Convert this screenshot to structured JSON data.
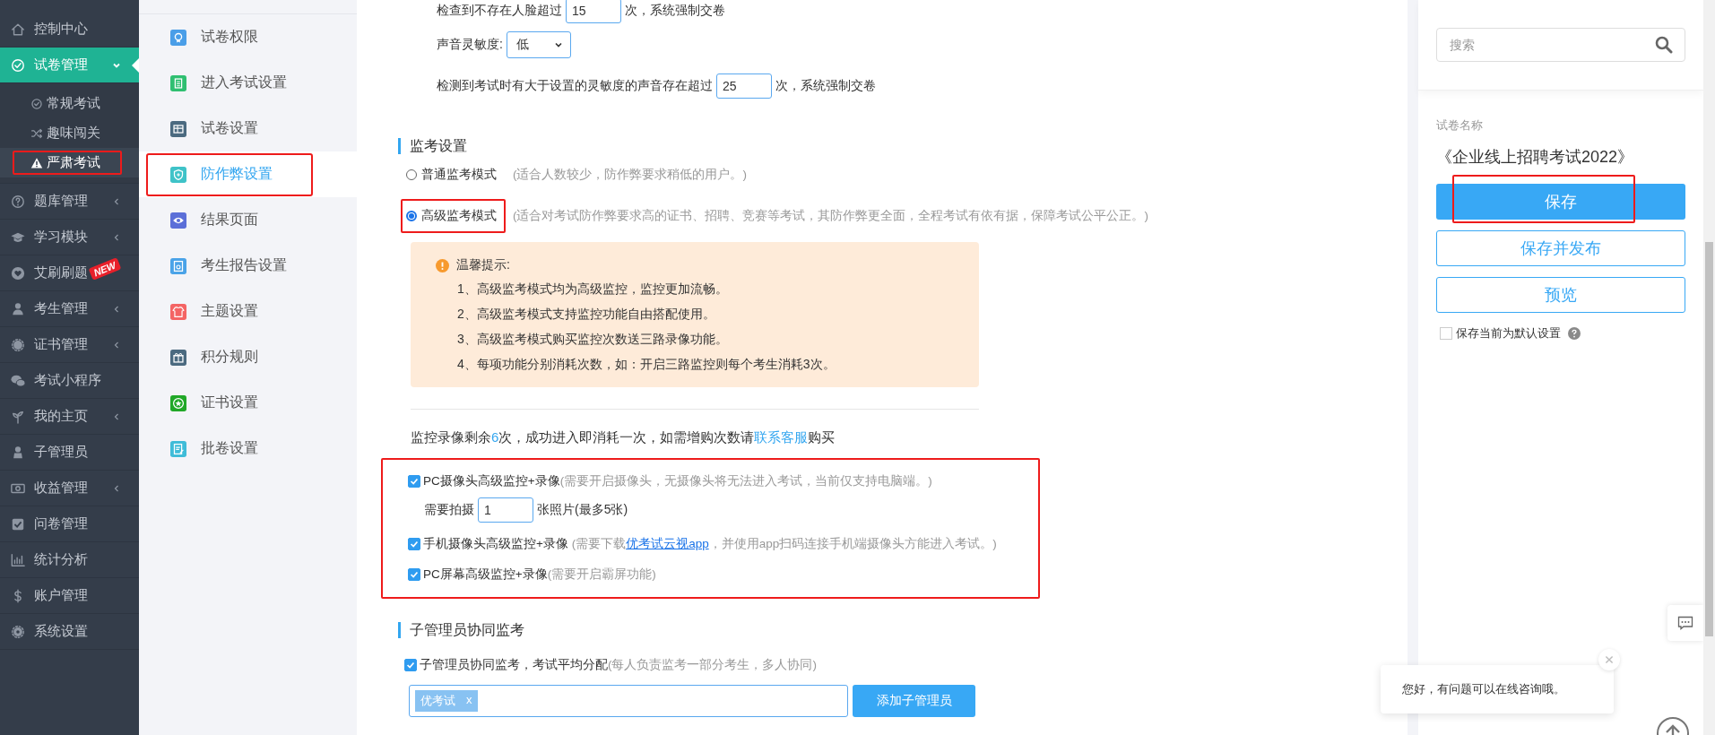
{
  "sidebar": {
    "items": [
      {
        "label": "控制中心",
        "selected": false,
        "expandable": false
      },
      {
        "label": "试卷管理",
        "selected": true,
        "expandable": true,
        "expanded": true,
        "children": [
          {
            "label": "常规考试",
            "selected": false,
            "highlighted": false
          },
          {
            "label": "趣味闯关",
            "selected": false,
            "highlighted": false
          },
          {
            "label": "严肃考试",
            "selected": true,
            "highlighted": true
          }
        ]
      },
      {
        "label": "题库管理",
        "selected": false,
        "expandable": true,
        "expanded": false
      },
      {
        "label": "学习模块",
        "selected": false,
        "expandable": true,
        "expanded": false
      },
      {
        "label": "艾刷刷题",
        "selected": false,
        "expandable": false,
        "badge": "NEW"
      },
      {
        "label": "考生管理",
        "selected": false,
        "expandable": true,
        "expanded": false
      },
      {
        "label": "证书管理",
        "selected": false,
        "expandable": true,
        "expanded": false
      },
      {
        "label": "考试小程序",
        "selected": false,
        "expandable": false
      },
      {
        "label": "我的主页",
        "selected": false,
        "expandable": true,
        "expanded": false
      },
      {
        "label": "子管理员",
        "selected": false,
        "expandable": false
      },
      {
        "label": "收益管理",
        "selected": false,
        "expandable": true,
        "expanded": false
      },
      {
        "label": "问卷管理",
        "selected": false,
        "expandable": false
      },
      {
        "label": "统计分析",
        "selected": false,
        "expandable": false
      },
      {
        "label": "账户管理",
        "selected": false,
        "expandable": false
      },
      {
        "label": "系统设置",
        "selected": false,
        "expandable": false
      }
    ]
  },
  "settings_nav": {
    "items": [
      {
        "label": "试卷权限",
        "color": "#4a9ee8",
        "selected": false,
        "highlighted": false
      },
      {
        "label": "进入考试设置",
        "color": "#2fbf71",
        "selected": false,
        "highlighted": false
      },
      {
        "label": "试卷设置",
        "color": "#4b6a80",
        "selected": false,
        "highlighted": false
      },
      {
        "label": "防作弊设置",
        "color": "#3fc3c8",
        "selected": true,
        "highlighted": true
      },
      {
        "label": "结果页面",
        "color": "#5b6fd8",
        "selected": false,
        "highlighted": false
      },
      {
        "label": "考生报告设置",
        "color": "#4aa3e8",
        "selected": false,
        "highlighted": false
      },
      {
        "label": "主题设置",
        "color": "#f46464",
        "selected": false,
        "highlighted": false
      },
      {
        "label": "积分规则",
        "color": "#4b6a80",
        "selected": false,
        "highlighted": false
      },
      {
        "label": "证书设置",
        "color": "#21a828",
        "selected": false,
        "highlighted": false
      },
      {
        "label": "批卷设置",
        "color": "#3fbcd8",
        "selected": false,
        "highlighted": false
      }
    ]
  },
  "main": {
    "face_row": {
      "before": "检查到不存在人脸超过",
      "value": "15",
      "after": "次，系统强制交卷"
    },
    "sound_sensitivity": {
      "label": "声音灵敏度:",
      "value": "低"
    },
    "sound_row": {
      "before": "检测到考试时有大于设置的灵敏度的声音存在超过",
      "value": "25",
      "after": "次，系统强制交卷"
    },
    "proctor_section": {
      "title": "监考设置",
      "modes": [
        {
          "label": "普通监考模式",
          "note": "(适合人数较少，防作弊要求稍低的用户。)",
          "selected": false,
          "highlighted": false
        },
        {
          "label": "高级监考模式",
          "note": "(适合对考试防作弊要求高的证书、招聘、竞赛等考试，其防作弊更全面，全程考试有依有据，保障考试公平公正。)",
          "selected": true,
          "highlighted": true
        }
      ]
    },
    "tips": {
      "title": "温馨提示:",
      "items": [
        "1、高级监考模式均为高级监控，监控更加流畅。",
        "2、高级监考模式支持监控功能自由搭配使用。",
        "3、高级监考模式购买监控次数送三路录像功能。",
        "4、每项功能分别消耗次数，如：开启三路监控则每个考生消耗3次。"
      ]
    },
    "quota": {
      "before": "监控录像剩余",
      "count": "6",
      "middle": "次，成功进入即消耗一次，如需增购次数请",
      "link": "联系客服",
      "after": "购买"
    },
    "recording": {
      "highlighted": true,
      "options": [
        {
          "kind": "photo",
          "label": "PC摄像头高级监控+录像",
          "note": "(需要开启摄像头，无摄像头将无法进入考试，当前仅支持电脑端。)",
          "checked": true,
          "photo": {
            "before": "需要拍摄",
            "value": "1",
            "after": "张照片(最多5张)"
          }
        },
        {
          "kind": "app",
          "label": "手机摄像头高级监控+录像",
          "note_before": "(需要下载",
          "link": "优考试云视app",
          "note_after": "，并使用app扫码连接手机端摄像头方能进入考试。)",
          "checked": true
        },
        {
          "kind": "plain",
          "label": "PC屏幕高级监控+录像",
          "note": "(需要开启霸屏功能)",
          "checked": true
        }
      ]
    },
    "subadmin": {
      "title": "子管理员协同监考",
      "checkbox": {
        "label": "子管理员协同监考，考试平均分配",
        "note": "(每人负责监考一部分考生，多人协同)",
        "checked": true
      },
      "tags": [
        {
          "label": "优考试",
          "remove": "x"
        }
      ],
      "add_button": "添加子管理员"
    }
  },
  "right_panel": {
    "search": {
      "placeholder": "搜索"
    },
    "paper_label": "试卷名称",
    "paper_name": "《企业线上招聘考试2022》",
    "buttons": [
      {
        "label": "保存",
        "kind": "primary",
        "highlighted": true
      },
      {
        "label": "保存并发布",
        "kind": "outline",
        "highlighted": false
      },
      {
        "label": "预览",
        "kind": "outline",
        "highlighted": false
      }
    ],
    "default_checkbox": {
      "label": "保存当前为默认设置",
      "checked": false
    }
  },
  "chat_popup": {
    "message": "您好，有问题可以在线咨询哦。"
  }
}
